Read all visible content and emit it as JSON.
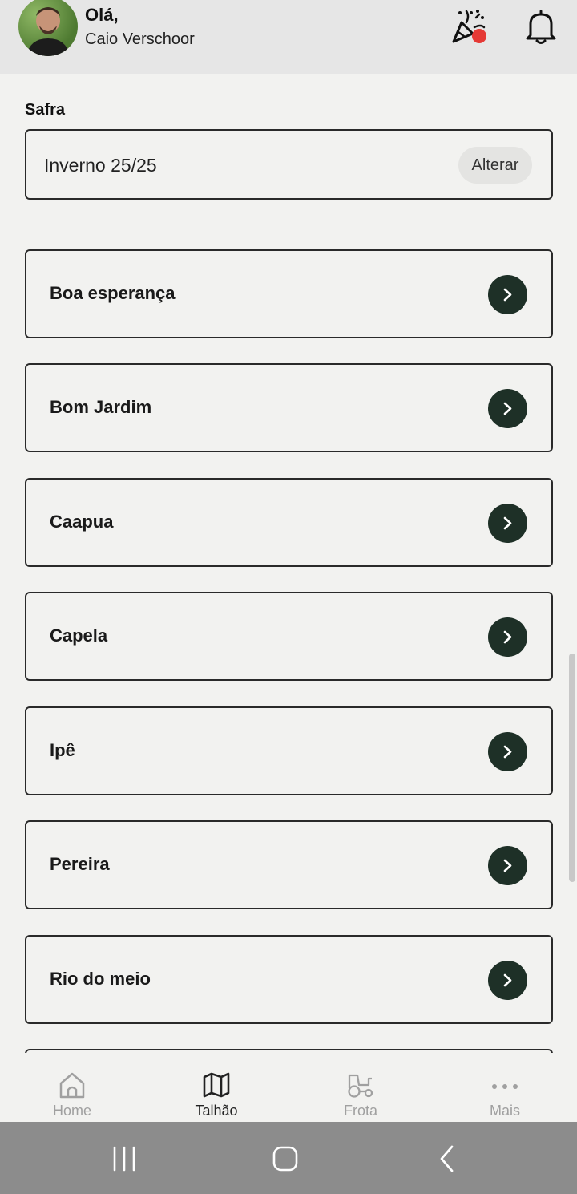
{
  "header": {
    "greeting": "Olá,",
    "user_name": "Caio Verschoor"
  },
  "safra": {
    "label": "Safra",
    "value": "Inverno 25/25",
    "change_label": "Alterar"
  },
  "farms": [
    {
      "name": "Boa esperança"
    },
    {
      "name": "Bom Jardim"
    },
    {
      "name": "Caapua"
    },
    {
      "name": "Capela"
    },
    {
      "name": "Ipê"
    },
    {
      "name": "Pereira"
    },
    {
      "name": "Rio do meio"
    }
  ],
  "nav": {
    "items": [
      {
        "label": "Home",
        "icon": "home-icon",
        "active": false
      },
      {
        "label": "Talhão",
        "icon": "map-icon",
        "active": true
      },
      {
        "label": "Frota",
        "icon": "tractor-icon",
        "active": false
      },
      {
        "label": "Mais",
        "icon": "more-icon",
        "active": false
      }
    ]
  },
  "colors": {
    "accent_dark_green": "#1e3027",
    "notification_dot": "#e53935",
    "nav_inactive": "#a0a0a0"
  }
}
